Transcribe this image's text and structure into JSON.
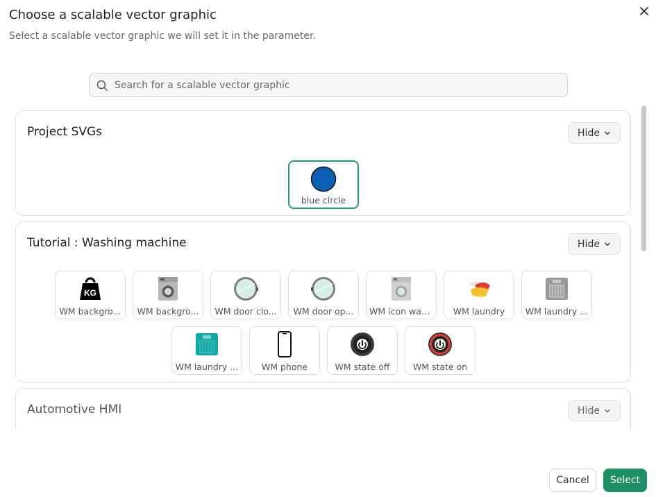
{
  "dialog": {
    "title": "Choose a scalable vector graphic",
    "subtitle": "Select a scalable vector graphic we will set it in the parameter.",
    "close_icon": "close-icon"
  },
  "search": {
    "placeholder": "Search for a scalable vector graphic",
    "value": ""
  },
  "sections": [
    {
      "title": "Project SVGs",
      "hide_label": "Hide",
      "items": [
        {
          "label": "blue circle",
          "icon": "blue-circle-icon",
          "selected": true
        }
      ]
    },
    {
      "title": "Tutorial : Washing machine",
      "hide_label": "Hide",
      "items": [
        {
          "label": "WM backgro...",
          "icon": "kg-weight-icon"
        },
        {
          "label": "WM backgro...",
          "icon": "washing-machine-icon"
        },
        {
          "label": "WM door clo...",
          "icon": "door-closed-icon"
        },
        {
          "label": "WM door op...",
          "icon": "door-open-icon"
        },
        {
          "label": "WM icon was...",
          "icon": "washer-small-icon"
        },
        {
          "label": "WM laundry",
          "icon": "laundry-icon"
        },
        {
          "label": "WM laundry ...",
          "icon": "laundry-grey-icon"
        },
        {
          "label": "WM laundry ...",
          "icon": "laundry-teal-icon"
        },
        {
          "label": "WM phone",
          "icon": "phone-icon"
        },
        {
          "label": "WM state off",
          "icon": "power-off-icon"
        },
        {
          "label": "WM state on",
          "icon": "power-on-icon"
        }
      ]
    },
    {
      "title": "Automotive HMI",
      "hide_label": "Hide",
      "items": []
    }
  ],
  "footer": {
    "cancel_label": "Cancel",
    "select_label": "Select"
  },
  "colors": {
    "accent": "#1f9063",
    "selected_border": "#1f9d6e",
    "circle_fill": "#0b5fb5"
  }
}
